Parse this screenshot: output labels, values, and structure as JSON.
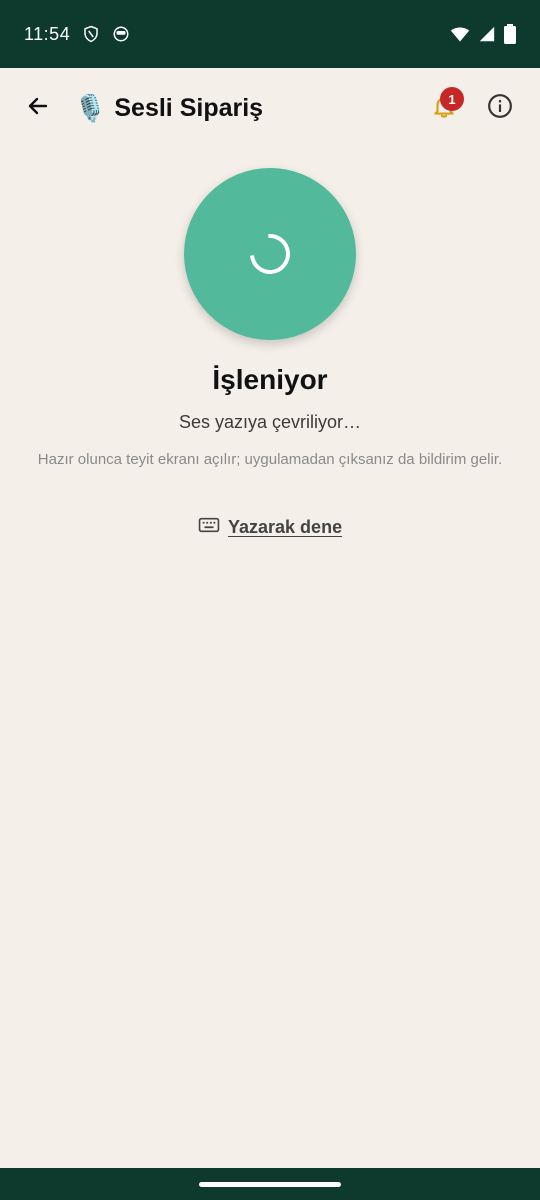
{
  "status_bar": {
    "time": "11:54",
    "icons": [
      "shield-icon",
      "face-icon",
      "wifi-icon",
      "signal-icon",
      "battery-icon"
    ]
  },
  "app_bar": {
    "title": "Sesli Sipariş",
    "title_emoji": "🎙️",
    "notification_count": "1",
    "icons": [
      "back-arrow-icon",
      "bell-icon",
      "info-icon"
    ]
  },
  "processing": {
    "title": "İşleniyor",
    "subtitle": "Ses yazıya çevriliyor…",
    "hint": "Hazır olunca teyit ekranı açılır; uygulamadan çıksanız da bildirim gelir.",
    "circle_color": "#52b99a"
  },
  "actions": {
    "type_instead_label": "Yazarak dene",
    "type_instead_icon": "keyboard-icon"
  },
  "colors": {
    "status_bar_bg": "#0d3a2c",
    "page_bg": "#f4efe8",
    "badge": "#c62828",
    "bell": "#d4a21a"
  }
}
